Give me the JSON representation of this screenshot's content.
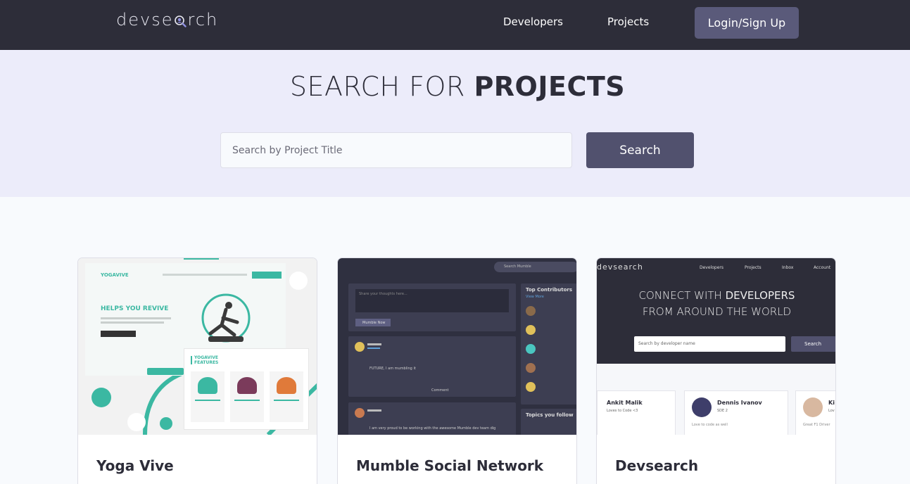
{
  "header": {
    "logo_prefix": "devse",
    "logo_suffix": "rch",
    "nav": [
      {
        "label": "Developers"
      },
      {
        "label": "Projects"
      }
    ],
    "login_label": "Login/Sign Up"
  },
  "hero": {
    "title_light": "SEARCH FOR ",
    "title_bold": "PROJECTS",
    "search_placeholder": "Search by Project Title",
    "search_button": "Search"
  },
  "projects": [
    {
      "title": "Yoga Vive",
      "thumb": {
        "brand": "YOGAVIVE",
        "headline": "HELPS YOU REVIVE",
        "features": "YOGAVIVE FEATURES"
      }
    },
    {
      "title": "Mumble Social Network",
      "thumb": {
        "search_placeholder": "Search Mumble",
        "compose_placeholder": "Share your thoughts here...",
        "post_button": "Mumble Now",
        "top_contributors": "Top Contributors",
        "view_more": "View More",
        "post_text_1": "FUTURE, I am mumbling it",
        "post_text_2": "I am very proud to be working with the awesome Mumble dev team dig",
        "comment": "Comment",
        "topics": "Topics you follow"
      }
    },
    {
      "title": "Devsearch",
      "thumb": {
        "logo": "devsearch",
        "nav": [
          "Developers",
          "Projects",
          "Inbox",
          "Account"
        ],
        "hero_line1_light": "CONNECT WITH ",
        "hero_line1_bold": "DEVELOPERS",
        "hero_line2": "FROM AROUND THE WORLD",
        "search_placeholder": "Search by developer name",
        "search_button": "Search",
        "devs": [
          {
            "name": "Ankit Malik",
            "role": "Loves to Code <3"
          },
          {
            "name": "Dennis Ivanov",
            "role": "SDE 2",
            "bio": "Love to code as well"
          },
          {
            "name": "Ki",
            "role": "Lov",
            "bio": "Great F1 Driver"
          }
        ]
      }
    }
  ],
  "colors": {
    "nav_bg": "#2d2d39",
    "hero_bg": "#ececfa",
    "button": "#51516e",
    "page_bg": "#f8fafd"
  }
}
